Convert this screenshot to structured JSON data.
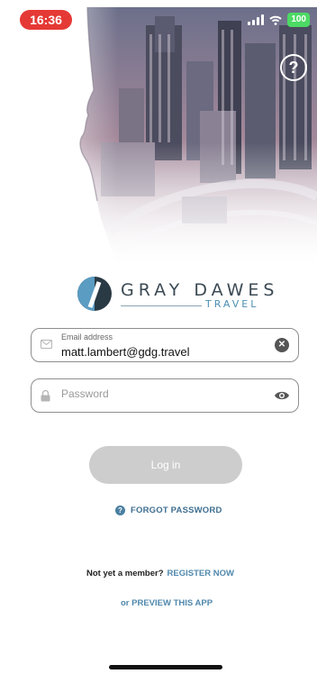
{
  "status_bar": {
    "time": "16:36",
    "battery": "100"
  },
  "header": {
    "help_label": "?"
  },
  "logo": {
    "brand_name": "GRAY DAWES",
    "brand_sub": "TRAVEL"
  },
  "login_form": {
    "email": {
      "label": "Email address",
      "value": "matt.lambert@gdg.travel"
    },
    "password": {
      "placeholder": "Password",
      "value": ""
    },
    "login_button": "Log in",
    "forgot_password": "FORGOT PASSWORD"
  },
  "footer": {
    "member_question": "Not yet a member?",
    "register_link": "REGISTER NOW",
    "preview_link": "or PREVIEW THIS APP"
  },
  "colors": {
    "accent": "#4f88ad",
    "status_time_bg": "#e53935",
    "battery": "#4cd964",
    "login_button_disabled": "#cdcdcd"
  }
}
